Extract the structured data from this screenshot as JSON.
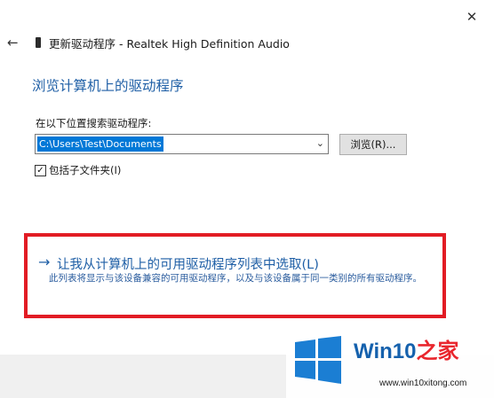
{
  "window": {
    "title": "更新驱动程序 - Realtek High Definition Audio",
    "close_glyph": "✕",
    "back_glyph": "←"
  },
  "page": {
    "heading": "浏览计算机上的驱动程序"
  },
  "search": {
    "label": "在以下位置搜索驱动程序:",
    "path_value": "C:\\Users\\Test\\Documents",
    "dropdown_glyph": "⌄",
    "browse_label": "浏览(R)..."
  },
  "include_subfolders": {
    "checked": true,
    "check_glyph": "✓",
    "label": "包括子文件夹(I)"
  },
  "pick_option": {
    "arrow_glyph": "→",
    "title": "让我从计算机上的可用驱动程序列表中选取(L)",
    "description": "此列表将显示与该设备兼容的可用驱动程序，以及与该设备属于同一类别的所有驱动程序。"
  },
  "watermark": {
    "brand_main": "Win10",
    "brand_accent": "之家",
    "url": "www.win10xitong.com",
    "logo_color": "#1b7ed3",
    "brand_color": "#1561ad",
    "accent_color": "#e9262d"
  },
  "colors": {
    "link_blue": "#1f5fa6",
    "selection_blue": "#0078d7",
    "highlight_red": "#e21c24"
  }
}
